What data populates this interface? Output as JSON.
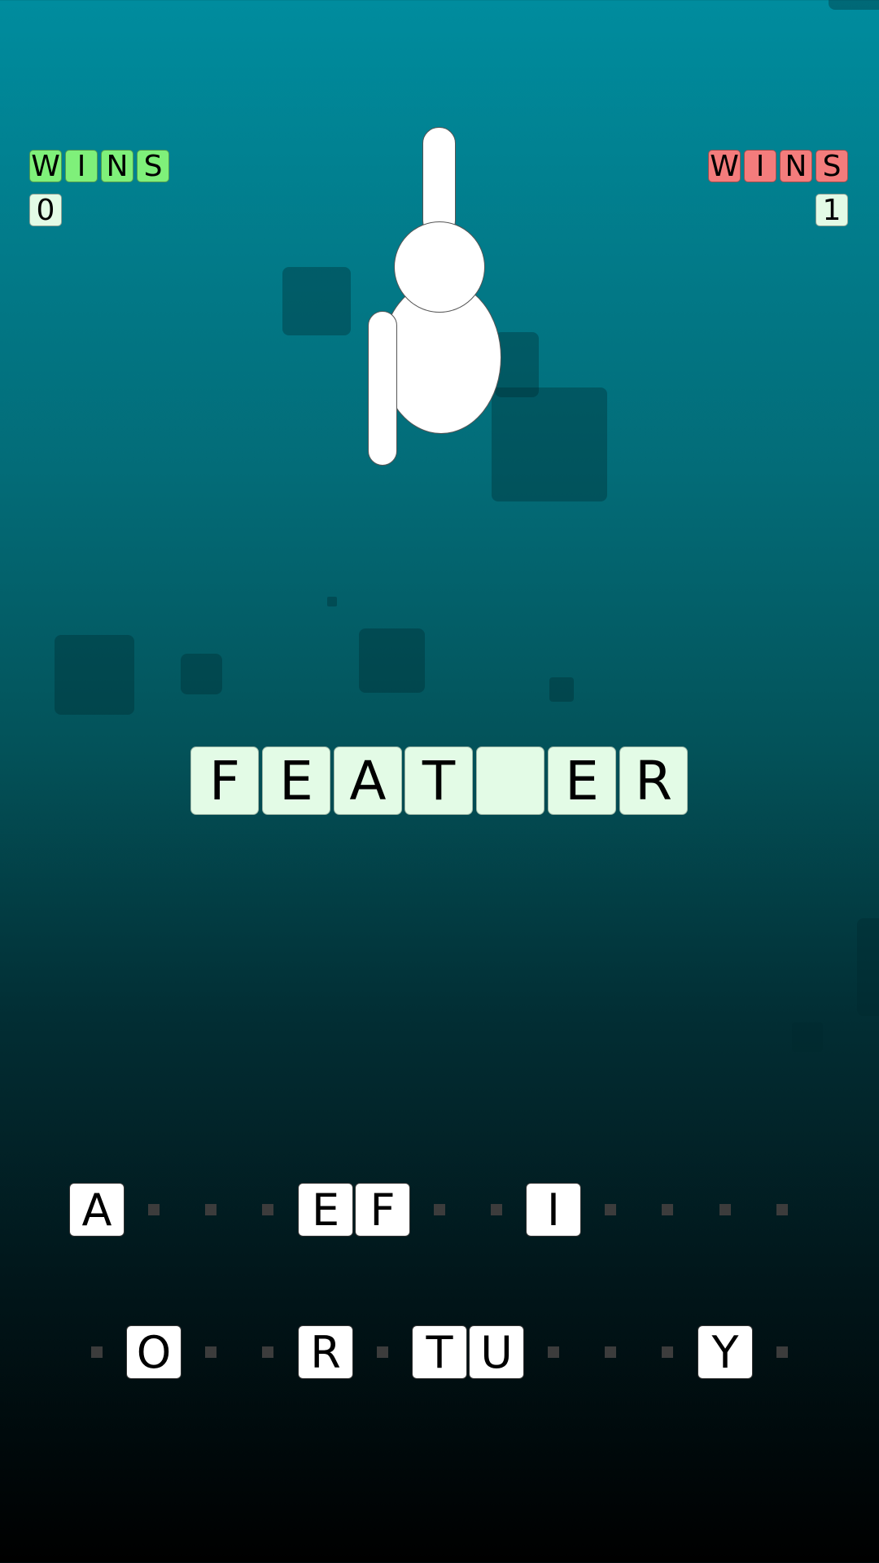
{
  "scores": {
    "left": {
      "label": [
        "W",
        "I",
        "N",
        "S"
      ],
      "value": "0",
      "color": "#7ff07a"
    },
    "right": {
      "label": [
        "W",
        "I",
        "N",
        "S"
      ],
      "value": "1",
      "color": "#f47c7c"
    }
  },
  "word": [
    "F",
    "E",
    "A",
    "T",
    "",
    "E",
    "R"
  ],
  "keyboard": {
    "row1": [
      "A",
      "",
      "",
      "",
      "E",
      "F",
      "",
      "",
      "I",
      "",
      "",
      "",
      ""
    ],
    "row2": [
      "",
      "O",
      "",
      "",
      "R",
      "",
      "T",
      "U",
      "",
      "",
      "",
      "Y",
      ""
    ]
  },
  "colors": {
    "tile_light": "#e3fbe6",
    "win_green": "#7ff07a",
    "win_red": "#f47c7c"
  }
}
